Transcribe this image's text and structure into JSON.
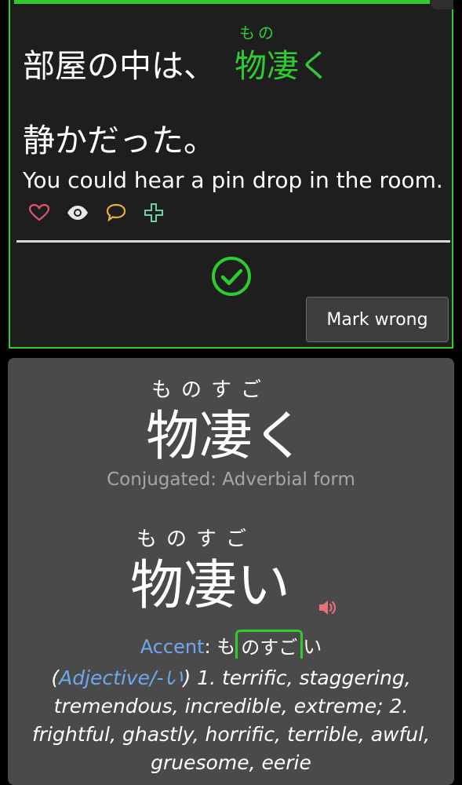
{
  "colors": {
    "accent_green": "#2ecc2e",
    "accent_blue": "#6fa8ef",
    "heart": "#e0566b",
    "comment": "#e8b040",
    "plus": "#6fcf9f",
    "speaker": "#e8707a"
  },
  "review": {
    "sentence_line1_prefix": "部屋の中は、",
    "target_word": "物凄く",
    "target_ruby": "もの",
    "sentence_line2": "静かだった。",
    "translation": "You could hear a pin drop in the room.",
    "icons": [
      "heart-icon",
      "eye-icon",
      "comment-icon",
      "plus-icon"
    ],
    "mark_wrong_label": "Mark wrong"
  },
  "detail": {
    "surface_ruby": "ものすご",
    "surface": "物凄く",
    "conjugated": "Conjugated: Adverbial form",
    "dictionary_ruby": "ものすご",
    "dictionary": "物凄い",
    "accent_label": "Accent",
    "accent_colon": ":",
    "accent_pre": "も",
    "accent_boxed": "のすご",
    "accent_post": "い",
    "pos_open": "(",
    "pos": "Adjective/-い",
    "pos_close": ")",
    "definition": "1. terrific, staggering, tremendous, incredible, extreme; 2. frightful, ghastly, horrific, terrible, awful, gruesome, eerie"
  }
}
